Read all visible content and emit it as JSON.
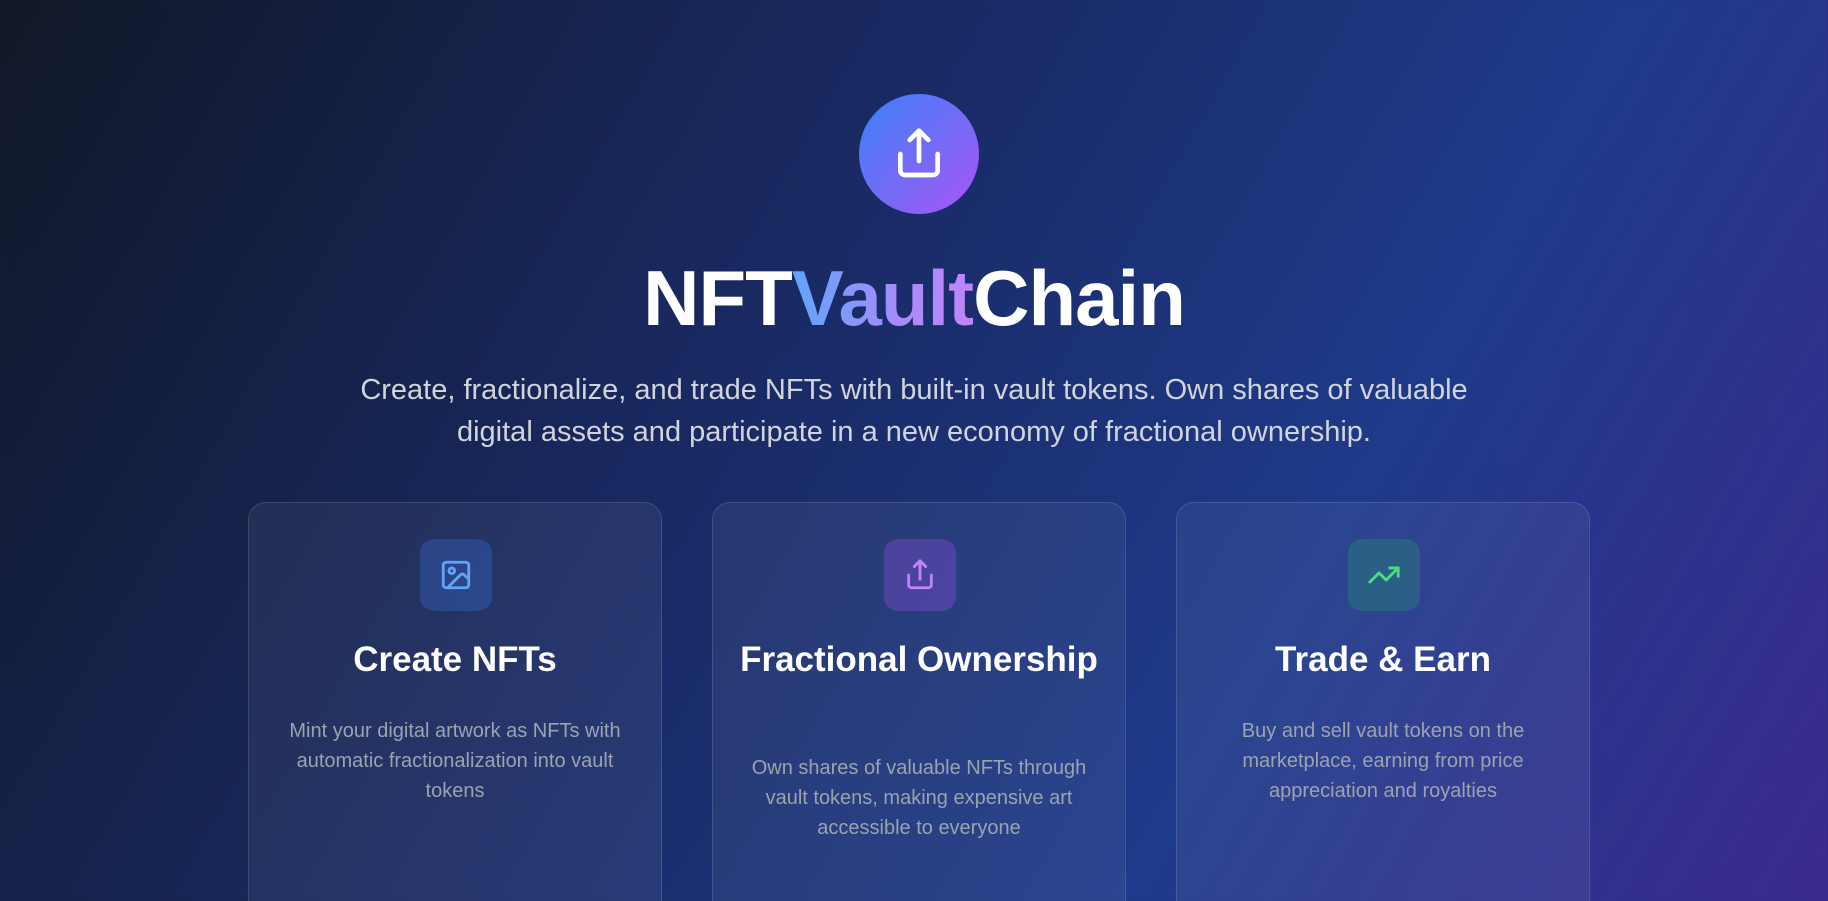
{
  "hero": {
    "logo_icon": "share-upload-icon",
    "title_part1": "NFT",
    "title_part2": "Vault",
    "title_part3": "Chain",
    "subtitle": "Create, fractionalize, and trade NFTs with built-in vault tokens. Own shares of valuable digital assets and participate in a new economy of fractional ownership."
  },
  "colors": {
    "logo_gradient_start": "#3b82f6",
    "logo_gradient_end": "#a855f7",
    "create_icon": "#60a5fa",
    "fractional_icon": "#c084fc",
    "trade_icon": "#4ade80"
  },
  "features": [
    {
      "icon": "image-icon",
      "title": "Create NFTs",
      "description": "Mint your digital artwork as NFTs with automatic fractionalization into vault tokens"
    },
    {
      "icon": "share-upload-icon",
      "title": "Fractional Ownership",
      "description": "Own shares of valuable NFTs through vault tokens, making expensive art accessible to everyone"
    },
    {
      "icon": "trending-up-icon",
      "title": "Trade & Earn",
      "description": "Buy and sell vault tokens on the marketplace, earning from price appreciation and royalties"
    }
  ]
}
